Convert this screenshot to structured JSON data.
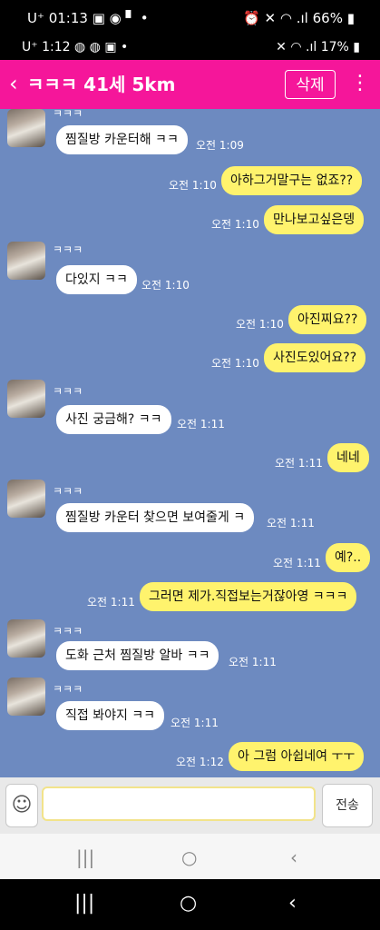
{
  "outer_status": {
    "time": "01:13",
    "carrier": "U⁺",
    "battery": "66%"
  },
  "inner_status": {
    "time": "1:12",
    "carrier": "U⁺",
    "battery": "17%"
  },
  "header": {
    "back_glyph": "‹",
    "title": "ㅋㅋㅋ 41세 5km",
    "delete_label": "삭제",
    "menu_glyph": "⋮"
  },
  "messages": [
    {
      "sender": "ㅋㅋㅋ",
      "text": "찜질방 카운터해 ㅋㅋ",
      "time": "오전 1:09"
    },
    {
      "text": "아하그거말구는 없죠??",
      "time": "오전 1:10"
    },
    {
      "text": "만나보고싶은뎅",
      "time": "오전 1:10"
    },
    {
      "sender": "ㅋㅋㅋ",
      "text": "다있지 ㅋㅋ",
      "time": "오전 1:10"
    },
    {
      "text": "아진찌요??",
      "time": "오전 1:10"
    },
    {
      "text": "사진도있어요??",
      "time": "오전 1:10"
    },
    {
      "sender": "ㅋㅋㅋ",
      "text": "사진 궁금해? ㅋㅋ",
      "time": "오전 1:11"
    },
    {
      "text": "네네",
      "time": "오전 1:11"
    },
    {
      "sender": "ㅋㅋㅋ",
      "text": "찜질방 카운터 찾으면 보여줄게 ㅋ",
      "time": "오전 1:11"
    },
    {
      "text": "예?..",
      "time": "오전 1:11"
    },
    {
      "text": "그러면 제가.직접보는거잖아영 ㅋㅋㅋ",
      "time": "오전 1:11"
    },
    {
      "sender": "ㅋㅋㅋ",
      "text": "도화 근처 찜질방 알바 ㅋㅋ",
      "time": "오전 1:11"
    },
    {
      "sender": "ㅋㅋㅋ",
      "text": "직접 봐야지 ㅋㅋ",
      "time": "오전 1:11"
    },
    {
      "text": "아 그럼 아쉽네여 ㅜㅜ",
      "time": "오전 1:12"
    }
  ],
  "input": {
    "emoji_glyph": "☺",
    "value": "",
    "send_label": "전송"
  },
  "nav": {
    "recents_glyph": "|||",
    "home_glyph": "○",
    "back_glyph": "‹"
  },
  "colors": {
    "header": "#f5169a",
    "chat_bg": "#6d8ac0",
    "outgoing_bubble": "#fff36d",
    "incoming_bubble": "#ffffff"
  }
}
